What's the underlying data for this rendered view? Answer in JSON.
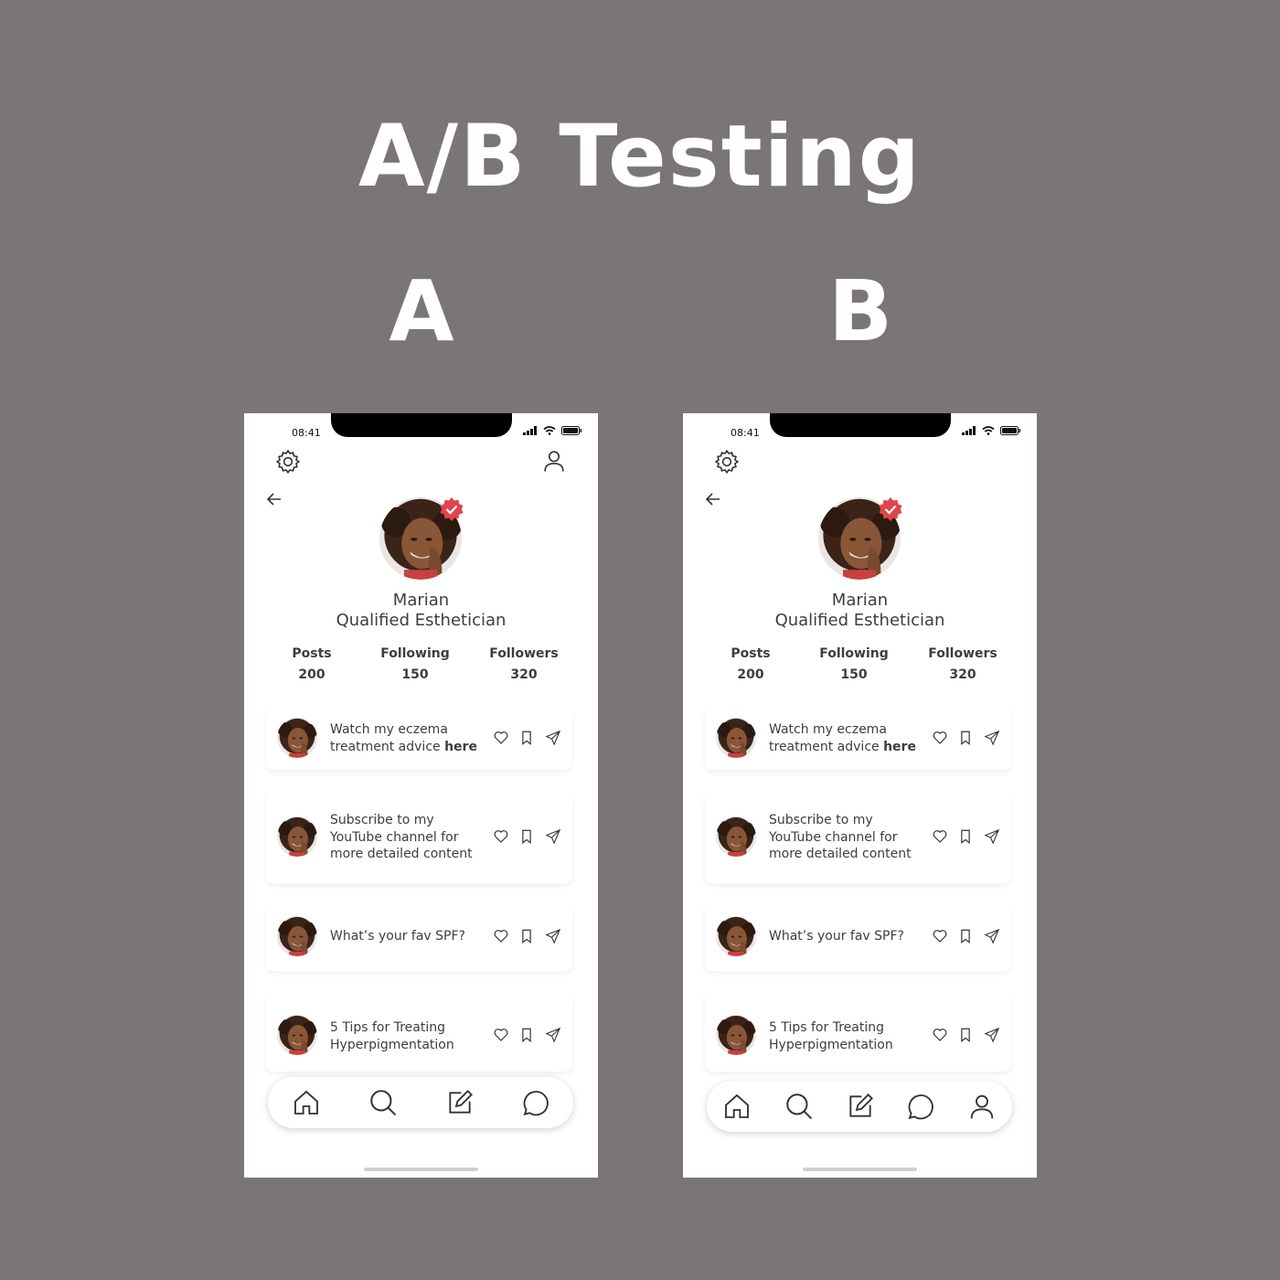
{
  "title": "A/B Testing",
  "variants": [
    {
      "label": "A",
      "nav_items": [
        "home-icon",
        "search-icon",
        "edit-icon",
        "chat-icon"
      ]
    },
    {
      "label": "B",
      "nav_items": [
        "home-icon",
        "search-icon",
        "edit-icon",
        "chat-icon",
        "profile-icon"
      ]
    }
  ],
  "phone": {
    "time": "08:41",
    "name": "Marian",
    "role": "Qualified Esthetician",
    "stats": [
      {
        "label": "Posts",
        "value": "200"
      },
      {
        "label": "Following",
        "value": "150"
      },
      {
        "label": "Followers",
        "value": "320"
      }
    ],
    "posts": [
      {
        "text": "Watch my eczema\ntreatment advice ",
        "bold": "here"
      },
      {
        "text": "Subscribe to my\nYouTube channel for\nmore detailed content",
        "bold": ""
      },
      {
        "text": "What’s your fav SPF?",
        "bold": ""
      },
      {
        "text": "5 Tips for Treating\nHyperpigmentation",
        "bold": ""
      }
    ]
  },
  "colors": {
    "background": "#7a7677",
    "verified_badge": "#e0454a",
    "text": "#3d3d3d"
  }
}
